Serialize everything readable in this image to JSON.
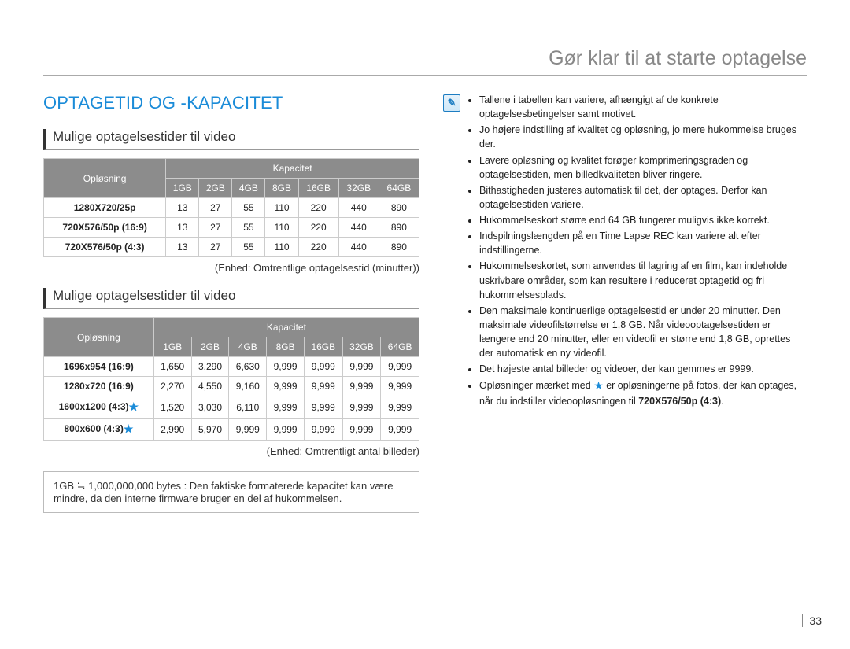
{
  "header": {
    "title": "Gør klar til at starte optagelse"
  },
  "main": {
    "heading": "OPTAGETID OG -KAPACITET",
    "sub1": "Mulige optagelsestider til video",
    "sub2": "Mulige optagelsestider til video"
  },
  "table_labels": {
    "resolution": "Opløsning",
    "capacity": "Kapacitet",
    "cols": [
      "1GB",
      "2GB",
      "4GB",
      "8GB",
      "16GB",
      "32GB",
      "64GB"
    ]
  },
  "table1": {
    "rows": [
      {
        "label": "1280X720/25p",
        "vals": [
          "13",
          "27",
          "55",
          "110",
          "220",
          "440",
          "890"
        ]
      },
      {
        "label": "720X576/50p (16:9)",
        "vals": [
          "13",
          "27",
          "55",
          "110",
          "220",
          "440",
          "890"
        ]
      },
      {
        "label": "720X576/50p (4:3)",
        "vals": [
          "13",
          "27",
          "55",
          "110",
          "220",
          "440",
          "890"
        ]
      }
    ],
    "caption": "(Enhed: Omtrentlige optagelsestid (minutter))"
  },
  "table2": {
    "rows": [
      {
        "label": "1696x954 (16:9)",
        "star": false,
        "vals": [
          "1,650",
          "3,290",
          "6,630",
          "9,999",
          "9,999",
          "9,999",
          "9,999"
        ]
      },
      {
        "label": "1280x720 (16:9)",
        "star": false,
        "vals": [
          "2,270",
          "4,550",
          "9,160",
          "9,999",
          "9,999",
          "9,999",
          "9,999"
        ]
      },
      {
        "label": "1600x1200 (4:3)",
        "star": true,
        "vals": [
          "1,520",
          "3,030",
          "6,110",
          "9,999",
          "9,999",
          "9,999",
          "9,999"
        ]
      },
      {
        "label": "800x600 (4:3)",
        "star": true,
        "vals": [
          "2,990",
          "5,970",
          "9,999",
          "9,999",
          "9,999",
          "9,999",
          "9,999"
        ]
      }
    ],
    "caption": "(Enhed: Omtrentligt antal billeder)"
  },
  "note": "1GB ≒ 1,000,000,000 bytes : Den faktiske formaterede kapacitet kan være mindre, da den interne firmware bruger en del af hukommelsen.",
  "info": {
    "items": [
      "Tallene i tabellen kan variere, afhængigt af de konkrete optagelsesbetingelser samt motivet.",
      "Jo højere indstilling af kvalitet og opløsning, jo mere hukommelse bruges der.",
      "Lavere opløsning og kvalitet forøger komprimeringsgraden og optagelsestiden, men billedkvaliteten bliver ringere.",
      "Bithastigheden justeres automatisk til det, der optages. Derfor kan optagelsestiden variere.",
      "Hukommelseskort større end 64 GB fungerer muligvis ikke korrekt.",
      "Indspilningslængden på en Time Lapse REC kan variere alt efter indstillingerne.",
      "Hukommelseskortet, som anvendes til lagring af en film, kan indeholde uskrivbare områder, som kan resultere i reduceret optagetid og fri hukommelsesplads.",
      "Den maksimale kontinuerlige optagelsestid er under 20 minutter. Den maksimale videofilstørrelse er 1,8 GB. Når videooptagelsestiden er længere end 20 minutter, eller en videofil er større end 1,8 GB, oprettes der automatisk en ny videofil.",
      "Det højeste antal billeder og videoer, der kan gemmes er 9999."
    ],
    "last_prefix": "Opløsninger mærket med ",
    "last_mid": " er opløsningerne på fotos, der kan optages, når du indstiller videoopløsningen til ",
    "last_bold": "720X576/50p (4:3)",
    "last_suffix": "."
  },
  "page_number": "33"
}
